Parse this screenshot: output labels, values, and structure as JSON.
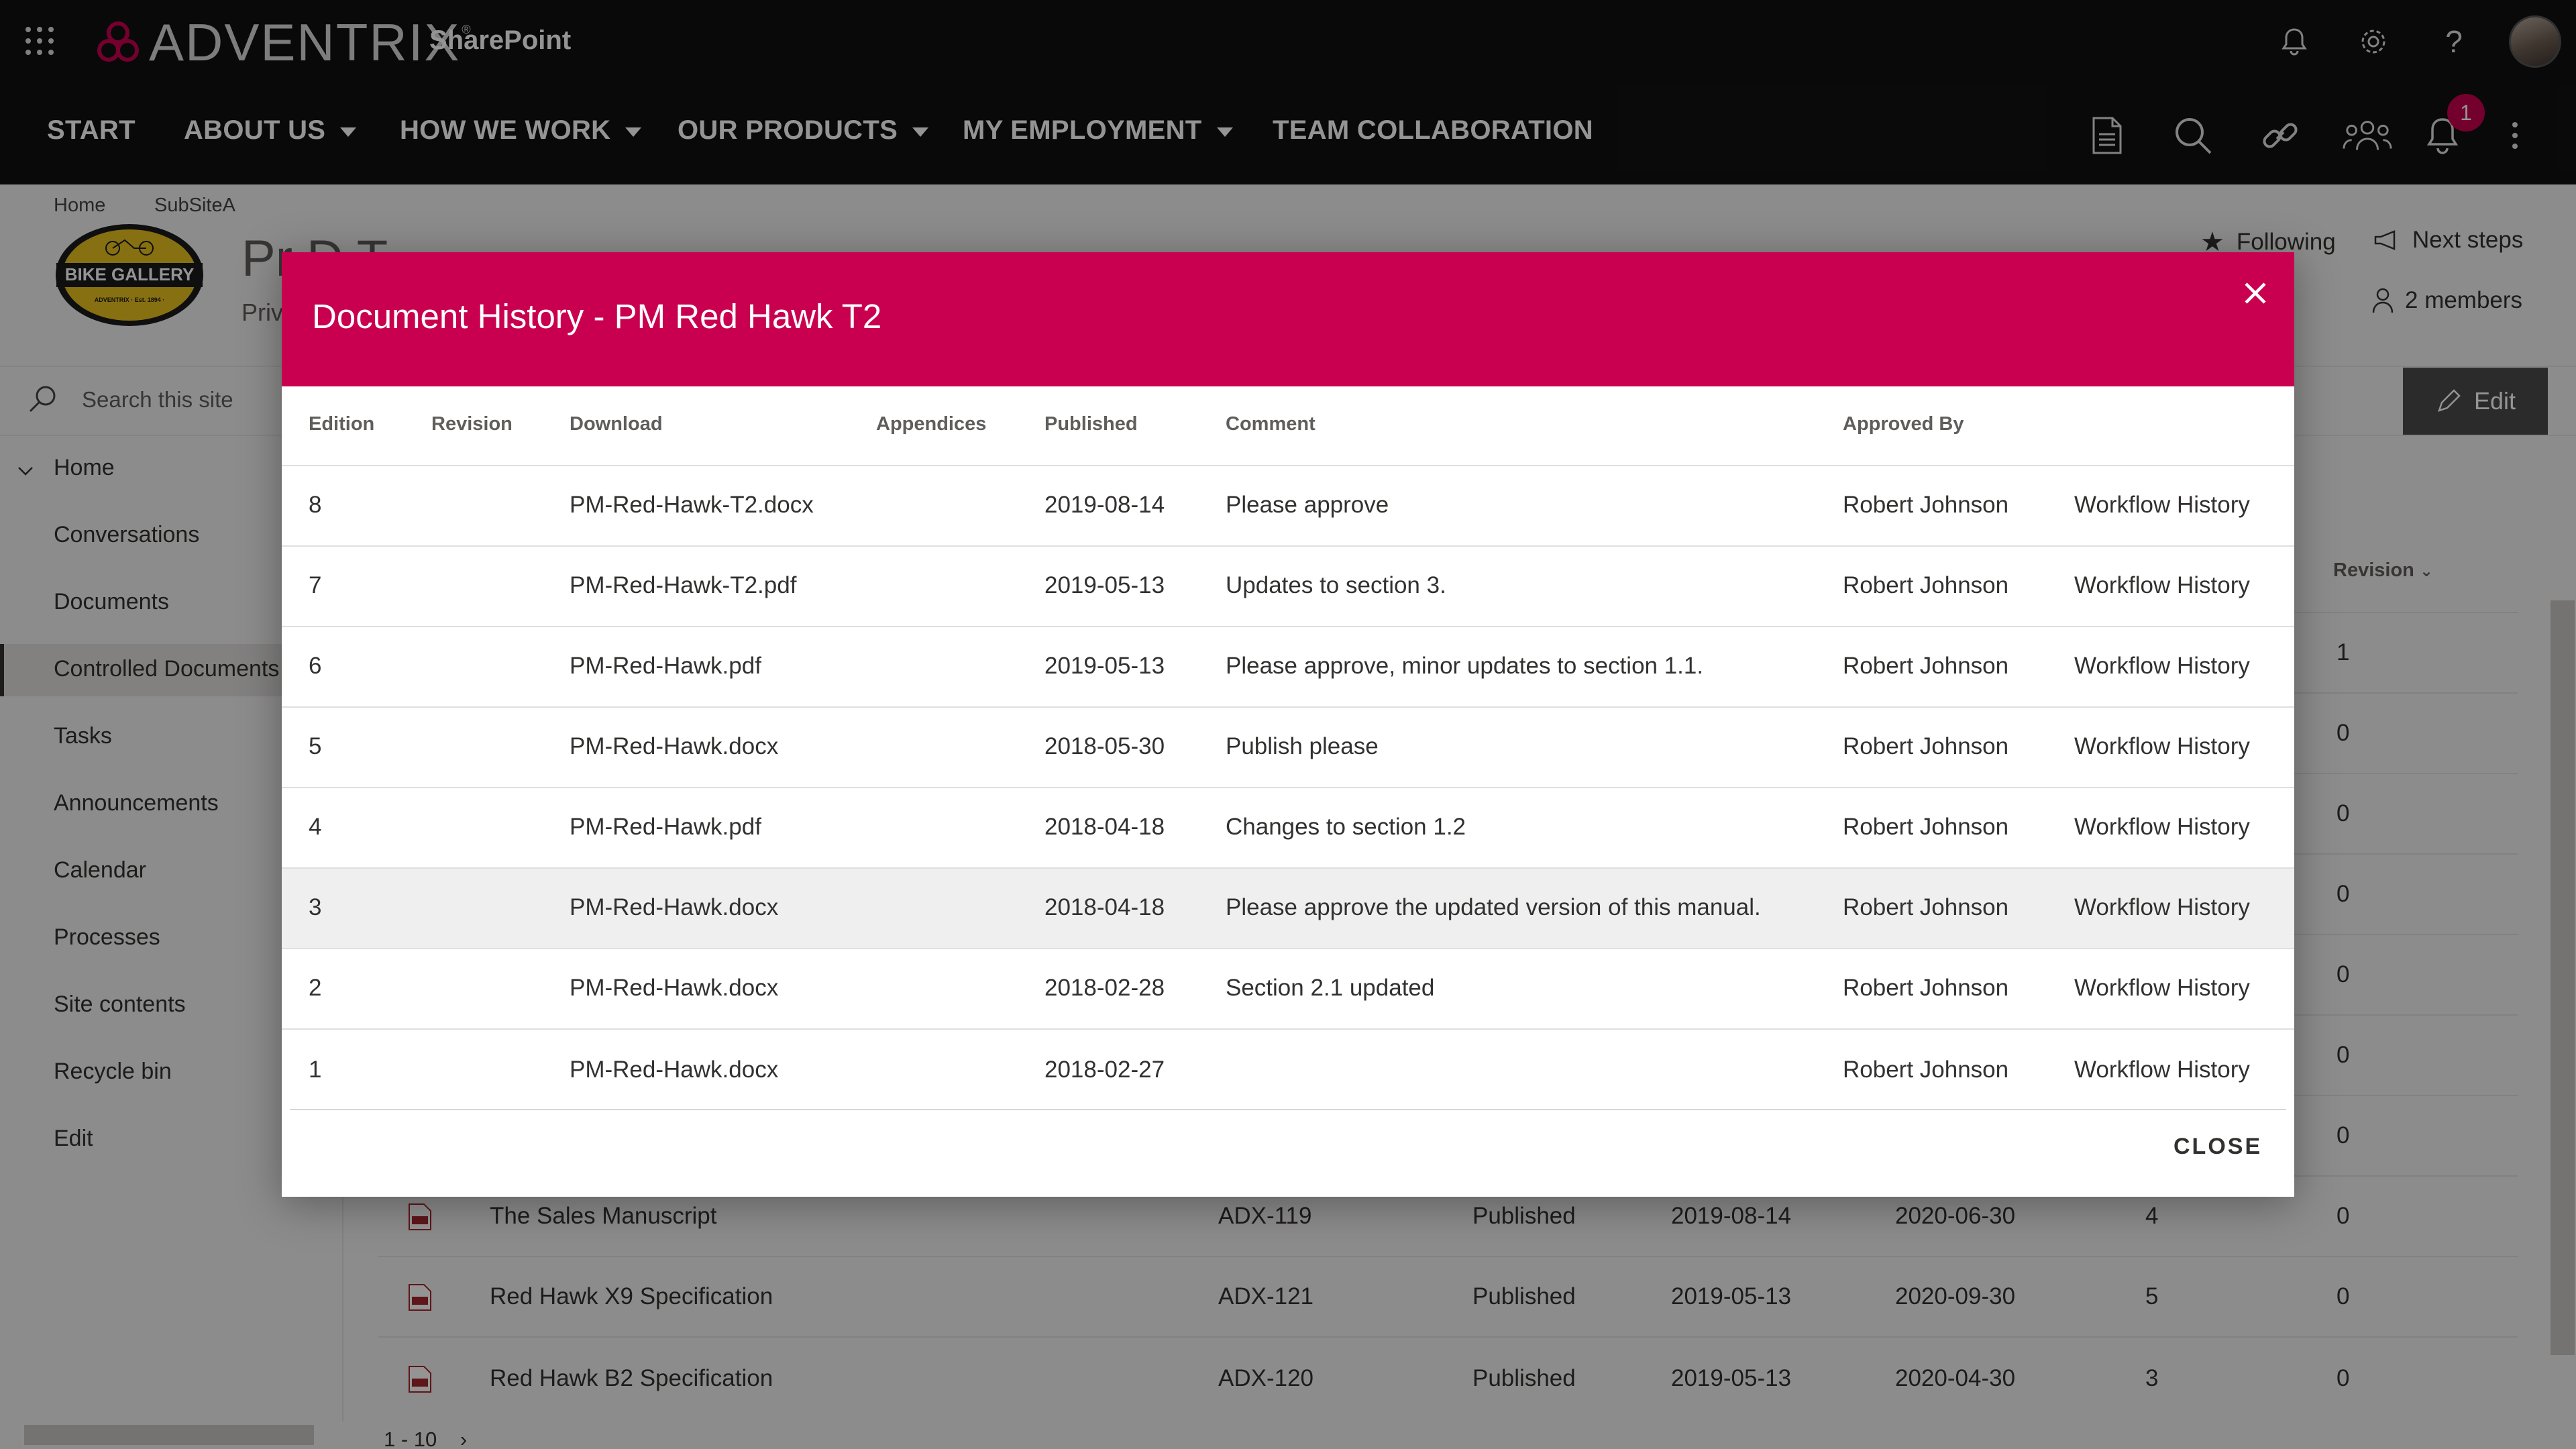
{
  "suite": {
    "brand": "ADVENTRIX",
    "brand_reg": "®",
    "app_name": "SharePoint"
  },
  "nav": {
    "items": [
      {
        "label": "START",
        "dropdown": false
      },
      {
        "label": "ABOUT US",
        "dropdown": true
      },
      {
        "label": "HOW WE WORK",
        "dropdown": true
      },
      {
        "label": "OUR PRODUCTS",
        "dropdown": true
      },
      {
        "label": "MY EMPLOYMENT",
        "dropdown": true
      },
      {
        "label": "TEAM COLLABORATION",
        "dropdown": false
      }
    ],
    "notification_count": "1"
  },
  "site": {
    "breadcrumb": [
      "Home",
      "SubSiteA"
    ],
    "title_partial": "Pr  D   T",
    "subtitle_partial": "Priv",
    "logo_text": "BIKE GALLERY",
    "logo_small": "ADVENTRIX · Est. 1894 ·",
    "following": "Following",
    "next_steps": "Next steps",
    "members": "2 members",
    "search_placeholder": "Search this site",
    "edit_label": "Edit"
  },
  "leftnav": {
    "items": [
      "Home",
      "Conversations",
      "Documents",
      "Controlled Documents",
      "Tasks",
      "Announcements",
      "Calendar",
      "Processes",
      "Site contents",
      "Recycle bin",
      "Edit"
    ],
    "active_index": 3
  },
  "background_list": {
    "revision_header": "Revision",
    "revision_column": [
      "1",
      "0",
      "0",
      "0",
      "0",
      "0",
      "0"
    ],
    "rows": [
      {
        "title": "The Sales Manuscript",
        "code": "ADX-119",
        "status": "Published",
        "published": "2019-08-14",
        "review": "2020-06-30",
        "edition": "4",
        "revision": "0"
      },
      {
        "title": "Red Hawk X9 Specification",
        "code": "ADX-121",
        "status": "Published",
        "published": "2019-05-13",
        "review": "2020-09-30",
        "edition": "5",
        "revision": "0"
      },
      {
        "title": "Red Hawk B2 Specification",
        "code": "ADX-120",
        "status": "Published",
        "published": "2019-05-13",
        "review": "2020-04-30",
        "edition": "3",
        "revision": "0"
      }
    ],
    "pager": "1 - 10"
  },
  "modal": {
    "title": "Document History - PM Red Hawk T2",
    "columns": [
      "Edition",
      "Revision",
      "Download",
      "Appendices",
      "Published",
      "Comment",
      "Approved By"
    ],
    "rows": [
      {
        "edition": "8",
        "revision": "",
        "download": "PM-Red-Hawk-T2.docx",
        "appendices": "",
        "published": "2019-08-14",
        "comment": "Please approve",
        "approved_by": "Robert Johnson",
        "workflow": "Workflow History"
      },
      {
        "edition": "7",
        "revision": "",
        "download": "PM-Red-Hawk-T2.pdf",
        "appendices": "",
        "published": "2019-05-13",
        "comment": "Updates to section 3.",
        "approved_by": "Robert Johnson",
        "workflow": "Workflow History"
      },
      {
        "edition": "6",
        "revision": "",
        "download": "PM-Red-Hawk.pdf",
        "appendices": "",
        "published": "2019-05-13",
        "comment": "Please approve, minor updates to section 1.1.",
        "approved_by": "Robert Johnson",
        "workflow": "Workflow History"
      },
      {
        "edition": "5",
        "revision": "",
        "download": "PM-Red-Hawk.docx",
        "appendices": "",
        "published": "2018-05-30",
        "comment": "Publish please",
        "approved_by": "Robert Johnson",
        "workflow": "Workflow History"
      },
      {
        "edition": "4",
        "revision": "",
        "download": "PM-Red-Hawk.pdf",
        "appendices": "",
        "published": "2018-04-18",
        "comment": "Changes to section 1.2",
        "approved_by": "Robert Johnson",
        "workflow": "Workflow History"
      },
      {
        "edition": "3",
        "revision": "",
        "download": "PM-Red-Hawk.docx",
        "appendices": "",
        "published": "2018-04-18",
        "comment": "Please approve the updated version of this manual.",
        "approved_by": "Robert Johnson",
        "workflow": "Workflow History"
      },
      {
        "edition": "2",
        "revision": "",
        "download": "PM-Red-Hawk.docx",
        "appendices": "",
        "published": "2018-02-28",
        "comment": "Section 2.1 updated",
        "approved_by": "Robert Johnson",
        "workflow": "Workflow History"
      },
      {
        "edition": "1",
        "revision": "",
        "download": "PM-Red-Hawk.docx",
        "appendices": "",
        "published": "2018-02-27",
        "comment": "",
        "approved_by": "Robert Johnson",
        "workflow": "Workflow History"
      }
    ],
    "highlighted_row": 5,
    "close_label": "CLOSE"
  },
  "colors": {
    "modal_header": "#c9004f",
    "suite_bar": "#111111",
    "badge": "#c8004e"
  },
  "icons": {
    "waffle": "waffle-icon",
    "bell": "bell-icon",
    "settings": "gear-icon",
    "help": "help-icon",
    "document": "document-icon",
    "search": "search-icon",
    "link": "link-icon",
    "people": "people-icon",
    "more": "more-vertical-icon",
    "close": "close-icon",
    "star": "star-icon",
    "megaphone": "megaphone-icon",
    "person": "person-icon",
    "pencil": "pencil-icon"
  }
}
